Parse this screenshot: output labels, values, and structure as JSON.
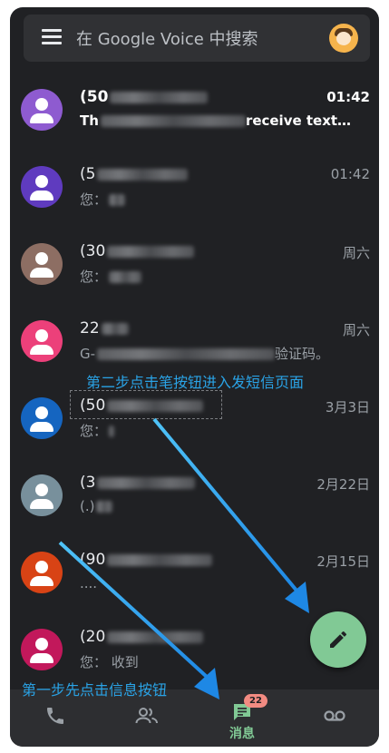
{
  "search": {
    "placeholder": "在 Google Voice 中搜索"
  },
  "conversations": [
    {
      "name": "(50",
      "time": "01:42",
      "preview": "Th",
      "preview_tail": "receive text…",
      "unread": true,
      "avatar_color": "#8e5bd0"
    },
    {
      "name": "(5",
      "time": "01:42",
      "preview": "您：",
      "unread": false,
      "avatar_color": "#5f3bbf"
    },
    {
      "name": "(30",
      "time": "周六",
      "preview": "您：",
      "unread": false,
      "avatar_color": "#8d6e63"
    },
    {
      "name": "22",
      "time": "周六",
      "preview": "G-",
      "preview_tail": "验证码。",
      "unread": false,
      "avatar_color": "#ec407a"
    },
    {
      "name": "(50",
      "time": "3月3日",
      "preview": "您：",
      "unread": false,
      "avatar_color": "#1565c0"
    },
    {
      "name": "(3",
      "time": "2月22日",
      "preview": "(.)",
      "unread": false,
      "avatar_color": "#78909c"
    },
    {
      "name": "(90",
      "time": "2月15日",
      "preview": "....",
      "unread": false,
      "avatar_color": "#d84315"
    },
    {
      "name": "(20",
      "time": "",
      "preview": "您：  收到",
      "unread": false,
      "avatar_color": "#c2185b"
    }
  ],
  "annotations": {
    "step_two": "第二步点击笔按钮进入发短信页面",
    "step_one": "第一步先点击信息按钮"
  },
  "bottom_nav": {
    "messages_label": "消息",
    "messages_badge": "22",
    "active_color": "#81c995"
  },
  "fab": {
    "icon": "pencil-icon"
  }
}
